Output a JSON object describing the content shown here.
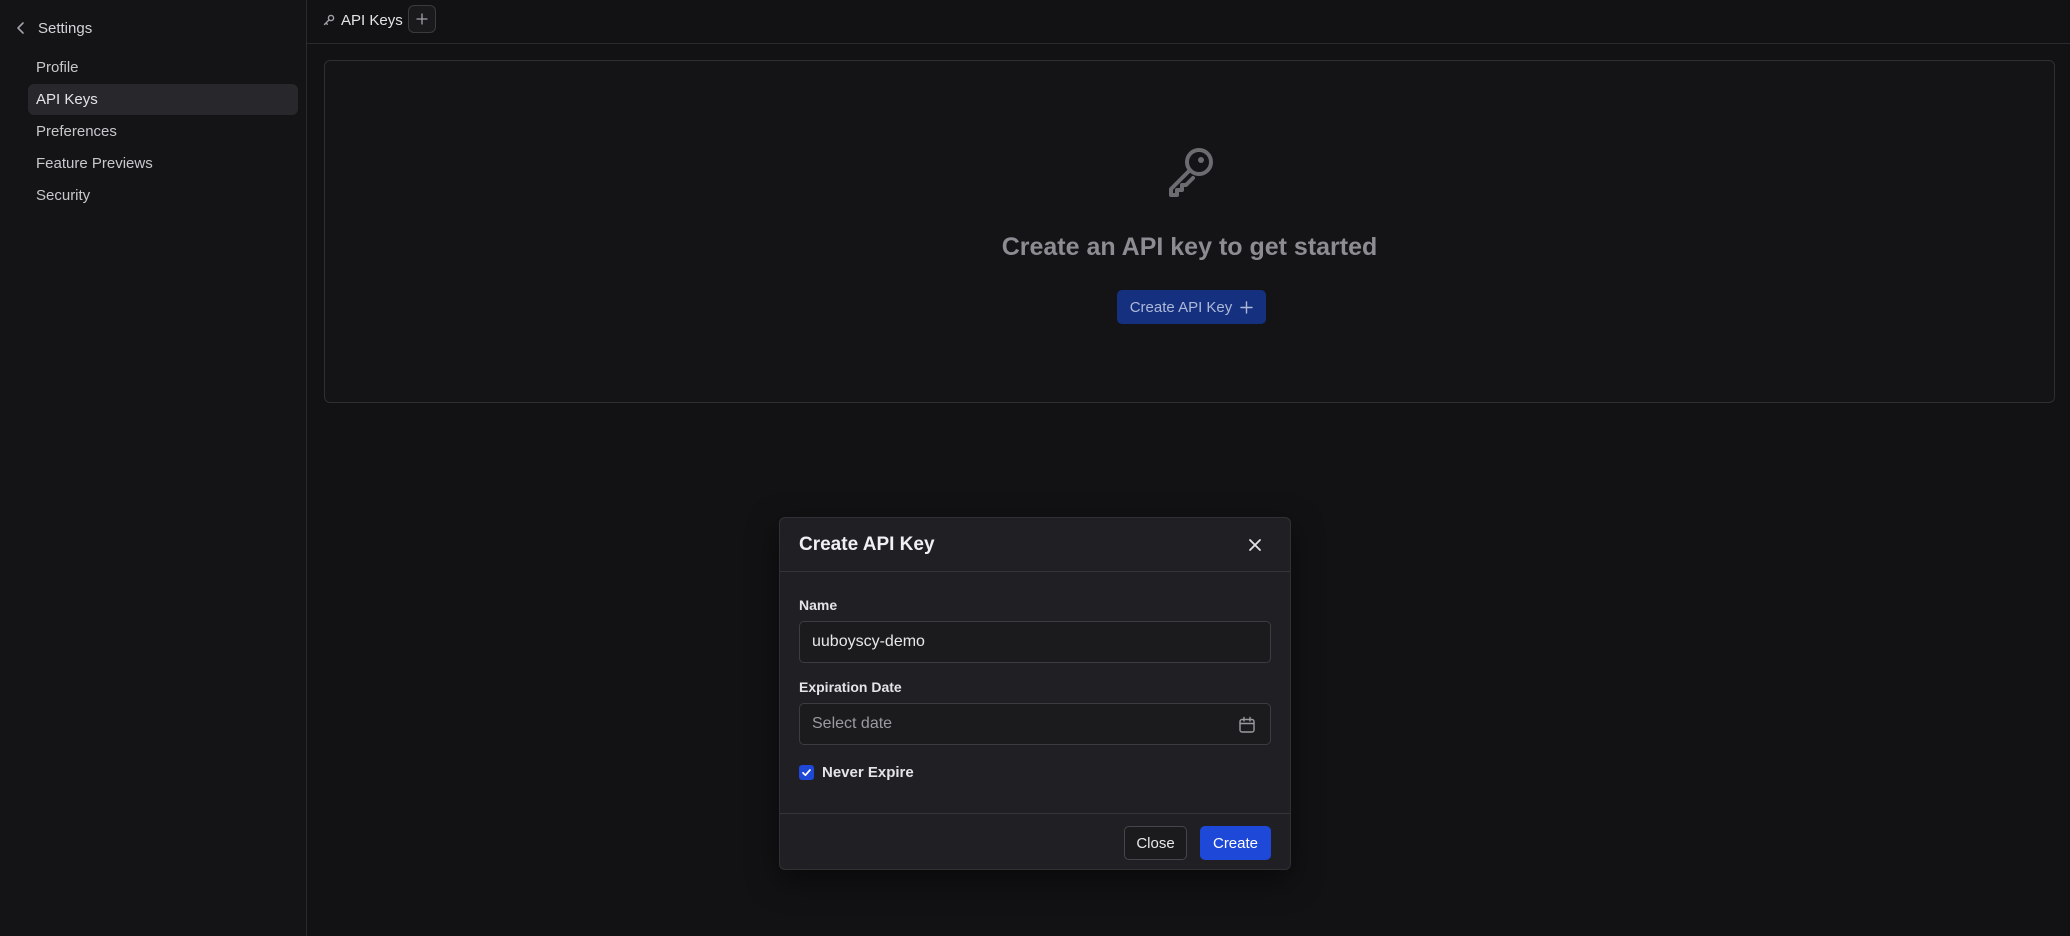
{
  "sidebar": {
    "back_label": "Settings",
    "items": [
      {
        "label": "Profile",
        "active": false
      },
      {
        "label": "API Keys",
        "active": true
      },
      {
        "label": "Preferences",
        "active": false
      },
      {
        "label": "Feature Previews",
        "active": false
      },
      {
        "label": "Security",
        "active": false
      }
    ]
  },
  "tabbar": {
    "tab_label": "API Keys",
    "tab_icon": "key-icon",
    "add_icon": "plus-icon"
  },
  "empty_state": {
    "icon": "key-icon",
    "title": "Create an API key to get started",
    "button_label": "Create API Key"
  },
  "modal": {
    "title": "Create API Key",
    "name_label": "Name",
    "name_value": "uuboyscy-demo",
    "expiration_label": "Expiration Date",
    "expiration_placeholder": "Select date",
    "never_expire_label": "Never Expire",
    "never_expire_checked": true,
    "close_label": "Close",
    "create_label": "Create"
  },
  "colors": {
    "accent": "#1d48d8",
    "background": "#121214",
    "panel": "#202024"
  }
}
